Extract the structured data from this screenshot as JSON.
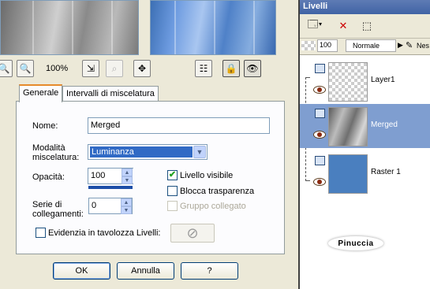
{
  "zoom": {
    "level": "100%"
  },
  "tabs": [
    {
      "label": "Generale"
    },
    {
      "label": "Intervalli di miscelatura"
    }
  ],
  "general": {
    "name_label": "Nome:",
    "name_value": "Merged",
    "blend_label_1": "Modalità",
    "blend_label_2": "miscelatura:",
    "blend_value": "Luminanza",
    "opacity_label": "Opacità:",
    "opacity_value": "100",
    "opacity_fraction": 1.0,
    "link_label_1": "Serie di",
    "link_label_2": "collegamenti:",
    "link_value": "0",
    "visible_label": "Livello visibile",
    "visible_checked": true,
    "lock_label": "Blocca trasparenza",
    "lock_checked": false,
    "linked_label": "Gruppo collegato",
    "linked_checked": false,
    "highlight_label": "Evidenzia in tavolozza Livelli:",
    "highlight_checked": false
  },
  "buttons": {
    "ok": "OK",
    "cancel": "Annulla",
    "help": "?"
  },
  "layers_panel": {
    "title": "Livelli",
    "opacity": "100",
    "blend_mode": "Normale",
    "cut_label": "Nes",
    "layers": [
      {
        "name": "Layer1",
        "thumb": "transparent",
        "selected": false
      },
      {
        "name": "Merged",
        "thumb": "image",
        "selected": true
      },
      {
        "name": "Raster 1",
        "thumb": "blue",
        "selected": false
      }
    ],
    "logo_text": "Pinuccia"
  },
  "colors": {
    "accent": "#316ac5",
    "selected_row": "#7f9ed0",
    "tab_highlight": "#e68b2c"
  },
  "icons": [
    "zoom-out-icon",
    "zoom-in-icon",
    "fit-window-icon",
    "zoom-actual-icon",
    "pan-icon",
    "properties-icon",
    "lock-icon",
    "visibility-icon",
    "new-layer-icon",
    "delete-layer-icon",
    "edit-selection-icon"
  ]
}
